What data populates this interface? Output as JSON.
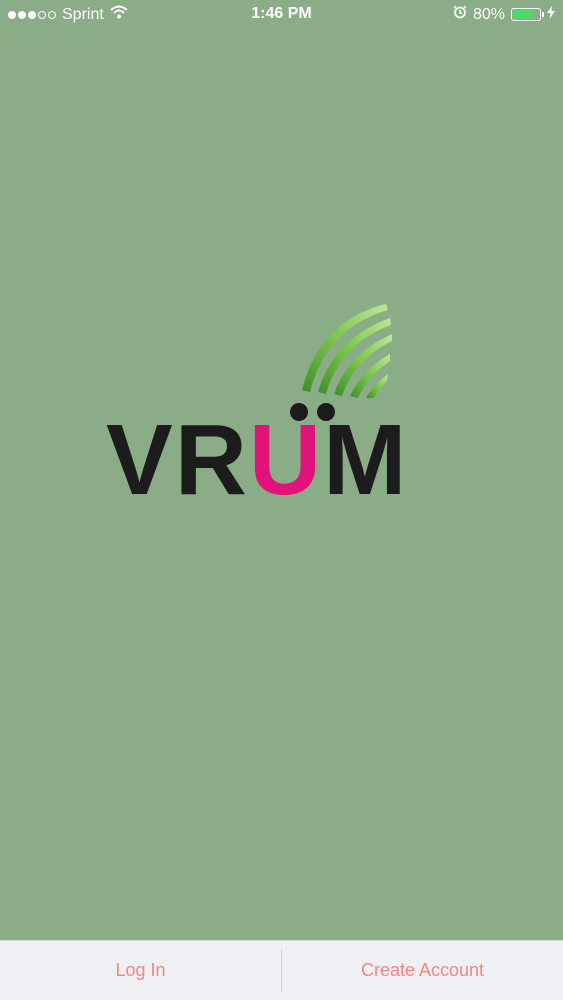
{
  "status_bar": {
    "carrier": "Sprint",
    "time": "1:46 PM",
    "battery_percent": "80%",
    "signal_bars_filled": 3,
    "signal_bars_total": 5,
    "battery_level": 0.8,
    "icons": [
      "wifi-icon",
      "alarm-icon",
      "battery-icon",
      "charging-bolt-icon"
    ]
  },
  "logo": {
    "text_part1": "VR",
    "text_part2": "U",
    "text_part3": "M",
    "colors": {
      "letters": "#1c1c1c",
      "accent_u": "#e0137c",
      "arcs": "#6fbf3e"
    }
  },
  "bottom_bar": {
    "login_label": "Log In",
    "create_account_label": "Create Account"
  },
  "colors": {
    "background": "#8aac86",
    "bottom_bar_bg": "#efeff4",
    "bottom_text": "#f0887c"
  }
}
